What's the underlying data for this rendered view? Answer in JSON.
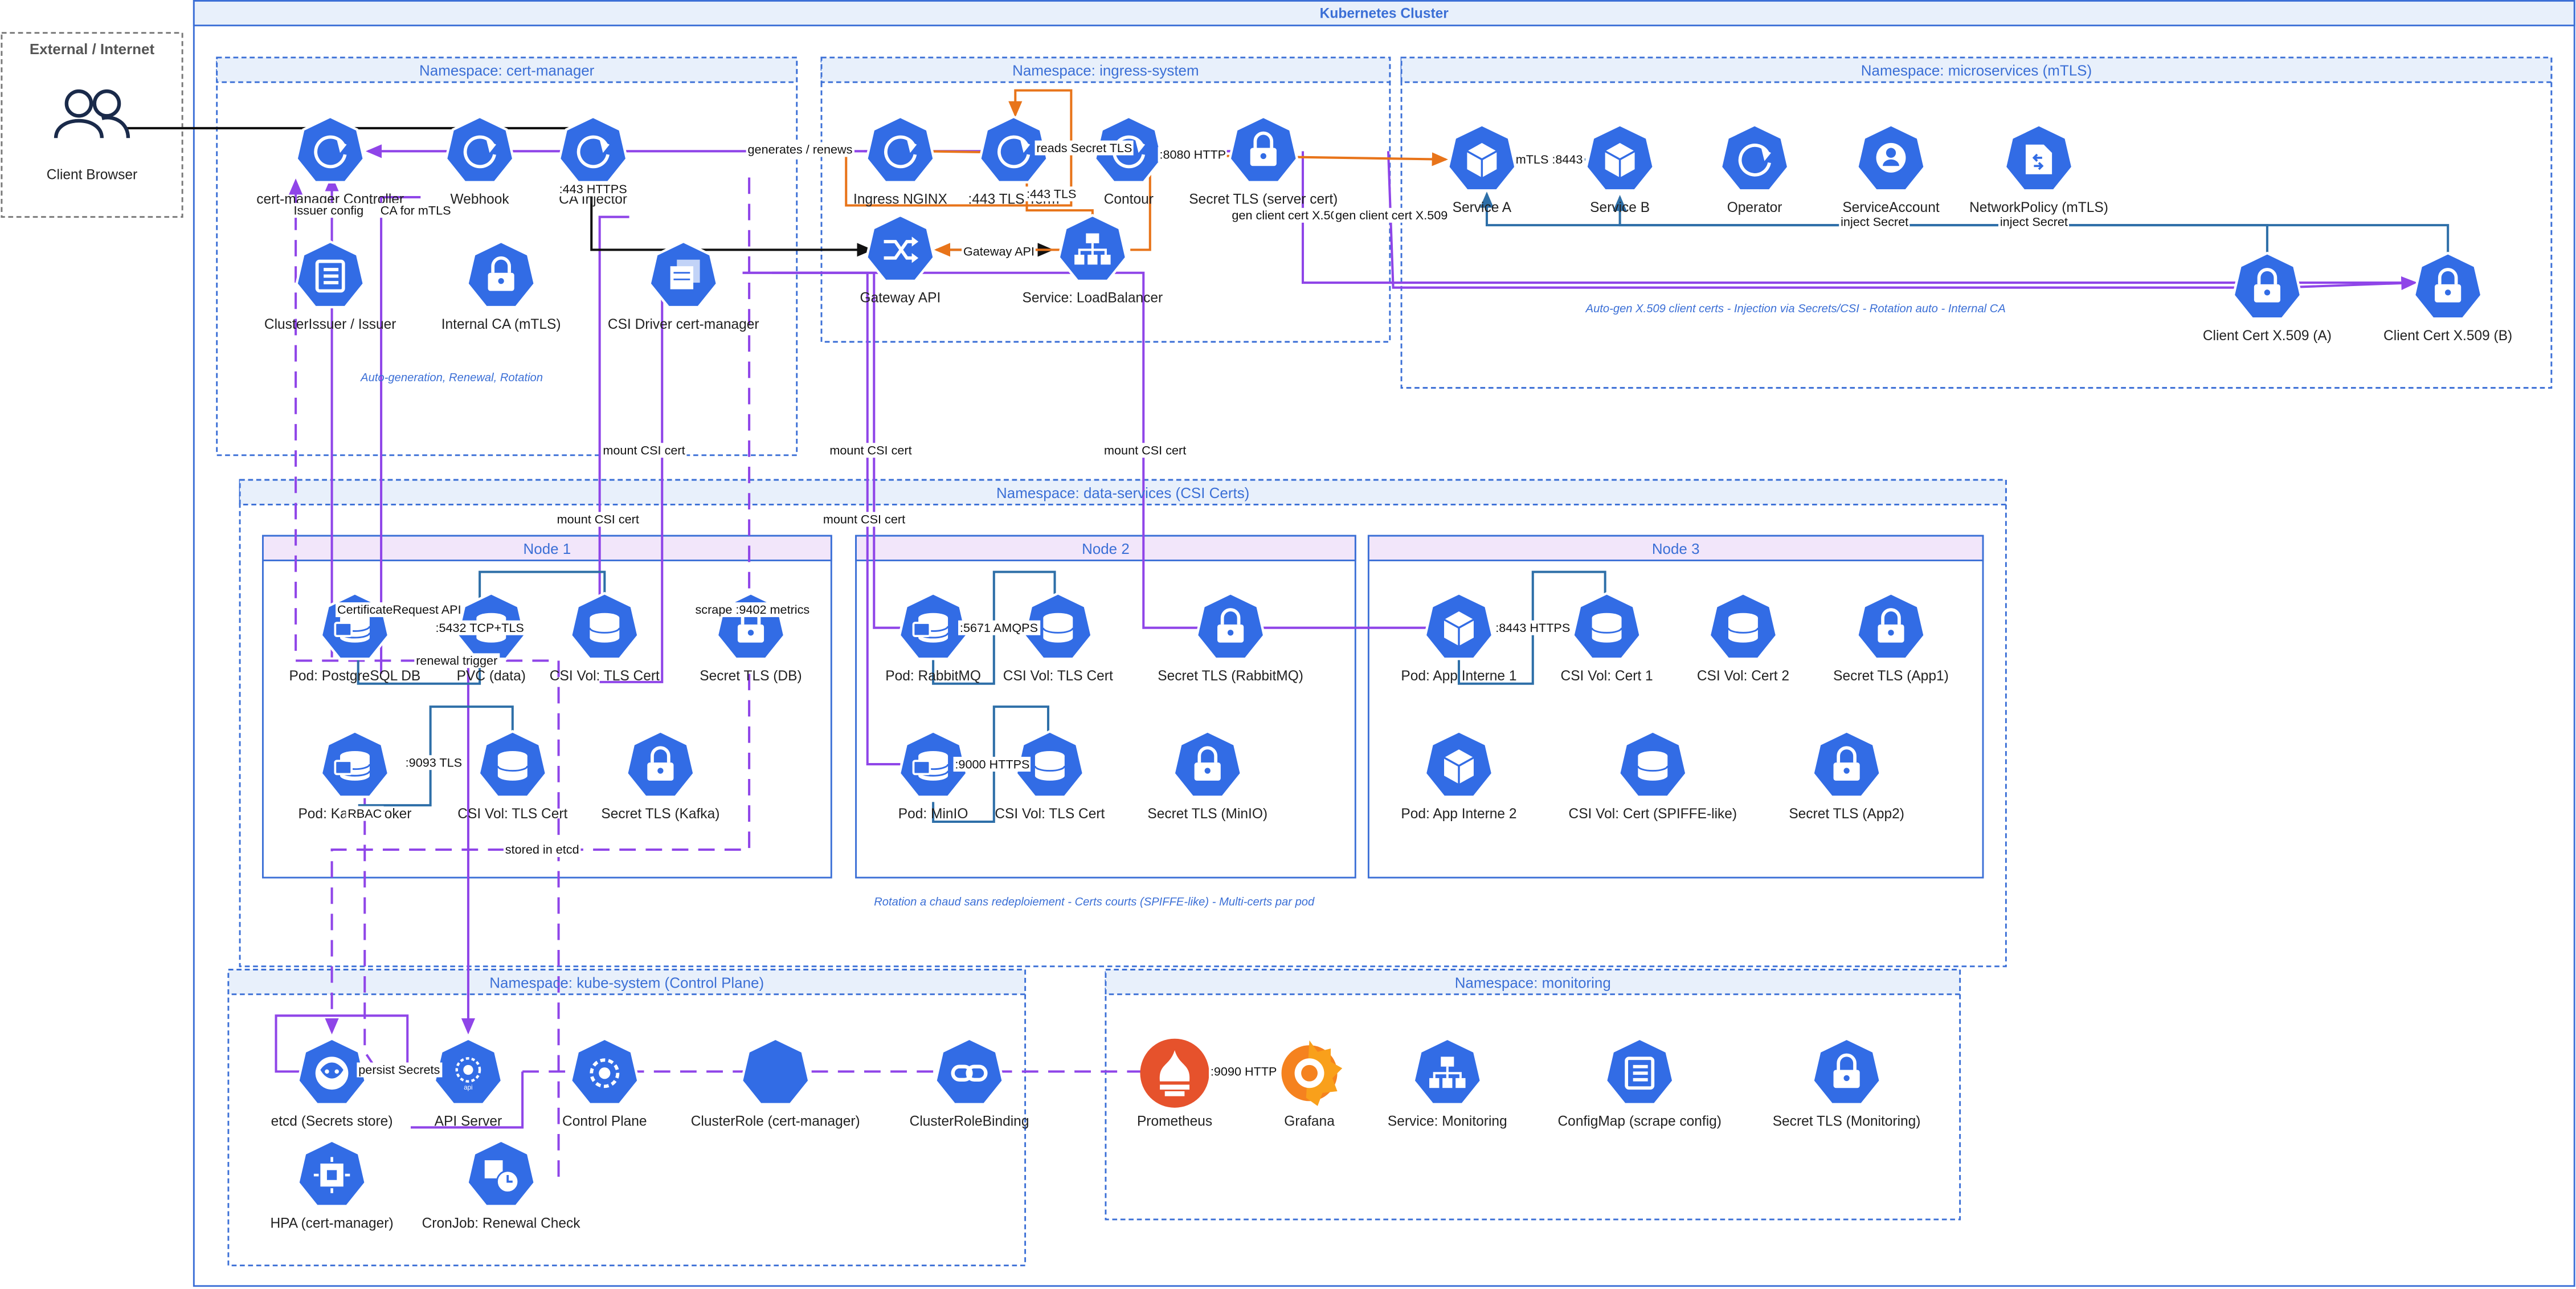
{
  "cluster_title": "Kubernetes Cluster",
  "external_title": "External / Internet",
  "client_label": "Client Browser",
  "namespaces": {
    "cert_manager": "Namespace: cert-manager",
    "ingress": "Namespace: ingress-system",
    "microservices": "Namespace: microservices (mTLS)",
    "data": "Namespace: data-services (CSI Certs)",
    "kube_system": "Namespace: kube-system (Control Plane)",
    "monitoring": "Namespace: monitoring"
  },
  "node_titles": {
    "n1": "Node 1",
    "n2": "Node 2",
    "n3": "Node 3"
  },
  "notes": {
    "cert_manager": "Auto-generation, Renewal, Rotation",
    "microservices": "Auto-gen X.509 client certs - Injection via Secrets/CSI - Rotation auto - Internal CA",
    "data": "Rotation a chaud sans redeploiement - Certs courts (SPIFFE-like) - Multi-certs par pod"
  },
  "nodes": {
    "cm_controller": {
      "label": "cert-manager Controller",
      "icon": "refresh-icon"
    },
    "webhook": {
      "label": "Webhook",
      "icon": "refresh-icon"
    },
    "ca_injector": {
      "label": "CA Injector",
      "icon": "refresh-icon"
    },
    "cluster_issuer": {
      "label": "ClusterIssuer / Issuer",
      "icon": "list-icon"
    },
    "internal_ca": {
      "label": "Internal CA (mTLS)",
      "icon": "lock-icon"
    },
    "csi_driver": {
      "label": "CSI Driver cert-manager",
      "icon": "volume-stack-icon"
    },
    "ingress_nginx": {
      "label": "Ingress NGINX",
      "icon": "refresh-icon"
    },
    "tls_term": {
      "label": ":443 TLS Term",
      "icon": "refresh-icon"
    },
    "contour": {
      "label": "Contour",
      "icon": "refresh-icon"
    },
    "secret_tls_server": {
      "label": "Secret TLS (server cert)",
      "icon": "lock-icon"
    },
    "gateway_api": {
      "label": "Gateway API",
      "icon": "shuffle-icon"
    },
    "svc_lb": {
      "label": "Service: LoadBalancer",
      "icon": "hierarchy-icon"
    },
    "service_a": {
      "label": "Service A",
      "icon": "cube-icon"
    },
    "service_b": {
      "label": "Service B",
      "icon": "cube-icon"
    },
    "operator": {
      "label": "Operator",
      "icon": "refresh-icon"
    },
    "service_account": {
      "label": "ServiceAccount",
      "icon": "user-icon"
    },
    "netpol": {
      "label": "NetworkPolicy (mTLS)",
      "icon": "netpol-icon"
    },
    "client_cert_a": {
      "label": "Client Cert X.509 (A)",
      "icon": "lock-icon"
    },
    "client_cert_b": {
      "label": "Client Cert X.509 (B)",
      "icon": "lock-icon"
    },
    "pod_postgres": {
      "label": "Pod: PostgreSQL DB",
      "icon": "database-icon"
    },
    "pvc_data": {
      "label": "PVC (data)",
      "icon": "volume-icon"
    },
    "csi_vol_tls_1": {
      "label": "CSI Vol: TLS Cert",
      "icon": "volume-icon"
    },
    "secret_tls_db": {
      "label": "Secret TLS (DB)",
      "icon": "lock-icon"
    },
    "pod_kafka": {
      "label": "Pod: Kafka Broker",
      "icon": "database-icon"
    },
    "csi_vol_tls_k": {
      "label": "CSI Vol: TLS Cert",
      "icon": "volume-icon"
    },
    "secret_tls_kafka": {
      "label": "Secret TLS (Kafka)",
      "icon": "lock-icon"
    },
    "pod_rabbit": {
      "label": "Pod: RabbitMQ",
      "icon": "database-icon"
    },
    "csi_vol_tls_r": {
      "label": "CSI Vol: TLS Cert",
      "icon": "volume-icon"
    },
    "secret_tls_rabbit": {
      "label": "Secret TLS (RabbitMQ)",
      "icon": "lock-icon"
    },
    "pod_minio": {
      "label": "Pod: MinIO",
      "icon": "database-icon"
    },
    "csi_vol_tls_m": {
      "label": "CSI Vol: TLS Cert",
      "icon": "volume-icon"
    },
    "secret_tls_minio": {
      "label": "Secret TLS (MinIO)",
      "icon": "lock-icon"
    },
    "pod_app1": {
      "label": "Pod: App Interne 1",
      "icon": "cube-icon"
    },
    "csi_cert1": {
      "label": "CSI Vol: Cert 1",
      "icon": "volume-icon"
    },
    "csi_cert2": {
      "label": "CSI Vol: Cert 2",
      "icon": "volume-icon"
    },
    "secret_app1": {
      "label": "Secret TLS (App1)",
      "icon": "lock-icon"
    },
    "pod_app2": {
      "label": "Pod: App Interne 2",
      "icon": "cube-icon"
    },
    "csi_spiffe": {
      "label": "CSI Vol: Cert (SPIFFE-like)",
      "icon": "volume-icon"
    },
    "secret_app2": {
      "label": "Secret TLS (App2)",
      "icon": "lock-icon"
    },
    "etcd": {
      "label": "etcd (Secrets store)",
      "icon": "etcd-icon"
    },
    "api_server": {
      "label": "API Server",
      "icon": "api-icon"
    },
    "control_plane": {
      "label": "Control Plane",
      "icon": "control-plane-icon"
    },
    "cluster_role": {
      "label": "ClusterRole (cert-manager)",
      "icon": "heptagon-icon"
    },
    "crb": {
      "label": "ClusterRoleBinding",
      "icon": "link-icon"
    },
    "hpa": {
      "label": "HPA (cert-manager)",
      "icon": "scale-icon"
    },
    "cronjob": {
      "label": "CronJob: Renewal Check",
      "icon": "cronjob-icon"
    },
    "prometheus": {
      "label": "Prometheus",
      "icon": "prometheus-icon"
    },
    "grafana": {
      "label": "Grafana",
      "icon": "grafana-icon"
    },
    "svc_mon": {
      "label": "Service: Monitoring",
      "icon": "hierarchy-icon"
    },
    "configmap": {
      "label": "ConfigMap (scrape config)",
      "icon": "list-icon"
    },
    "secret_mon": {
      "label": "Secret TLS (Monitoring)",
      "icon": "lock-icon"
    }
  },
  "edge_labels": {
    "generates_renews": "generates / renews",
    "https_443": ":443 HTTPS",
    "issuer_config": "Issuer config",
    "ca_for_mtls": "CA for mTLS",
    "reads_secret_tls": "reads Secret TLS",
    "tls_443": ":443 TLS",
    "http_8080": ":8080 HTTP",
    "gateway_api": "Gateway API",
    "gen_client_a": "gen client cert X.509",
    "gen_client_b": "gen client cert X.509",
    "mtls_8443": "mTLS :8443",
    "inject_secret_1": "inject Secret",
    "inject_secret_2": "inject Secret",
    "mount_csi_1": "mount CSI cert",
    "mount_csi_2": "mount CSI cert",
    "mount_csi_3": "mount CSI cert",
    "mount_csi_4": "mount CSI cert",
    "mount_csi_5": "mount CSI cert",
    "cert_request_api": "CertificateRequest API",
    "tcp_5432": ":5432 TCP+TLS",
    "renewal_trigger": "renewal trigger",
    "scrape_9402": "scrape :9402 metrics",
    "tls_9093": ":9093 TLS",
    "rbac": "RBAC",
    "amqps_5671": ":5671 AMQPS",
    "https_9000": ":9000 HTTPS",
    "https_8443": ":8443 HTTPS",
    "stored_in_etcd": "stored in etcd",
    "persist_secrets": "persist Secrets",
    "http_9090": ":9090 HTTP"
  },
  "colors": {
    "icon_blue": "#326ce5",
    "purple": "#8f45e8",
    "orange": "#e8741a",
    "steel_blue": "#2e6fa8",
    "black": "#111111"
  }
}
